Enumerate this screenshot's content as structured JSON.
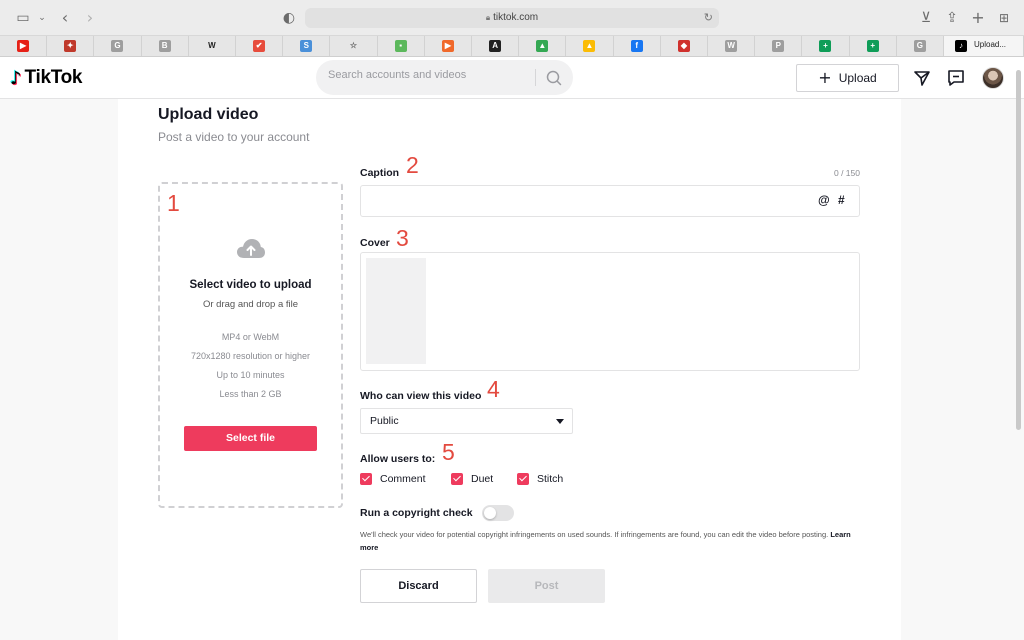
{
  "browser": {
    "url": "tiktok.com",
    "active_tab_label": "Upload..."
  },
  "bookmarks": [
    {
      "icon": "youtube-icon",
      "glyph": "▶",
      "color": "#e62117"
    },
    {
      "icon": "app-icon-red",
      "glyph": "✦",
      "color": "#c0392b"
    },
    {
      "icon": "letter-g-icon",
      "glyph": "G",
      "color": "#9e9e9e"
    },
    {
      "icon": "letter-b-icon",
      "glyph": "B",
      "color": "#9e9e9e"
    },
    {
      "icon": "wikipedia-icon",
      "glyph": "W",
      "color": "#ffffff"
    },
    {
      "icon": "checkmark-icon",
      "glyph": "✔",
      "color": "#e74c3c"
    },
    {
      "icon": "letter-s-icon",
      "glyph": "S",
      "color": "#4a90d9"
    },
    {
      "icon": "star-icon",
      "glyph": "☆",
      "color": "#666666"
    },
    {
      "icon": "green-app-icon",
      "glyph": "▪",
      "color": "#5cb85c"
    },
    {
      "icon": "orange-play-icon",
      "glyph": "▶",
      "color": "#f0692b"
    },
    {
      "icon": "adobe-icon",
      "glyph": "A",
      "color": "#222222"
    },
    {
      "icon": "google-drive-icon",
      "glyph": "▲",
      "color": "#34a853"
    },
    {
      "icon": "google-drive-icon-2",
      "glyph": "▲",
      "color": "#fbbc05"
    },
    {
      "icon": "facebook-icon",
      "glyph": "f",
      "color": "#1877f2"
    },
    {
      "icon": "red-app-icon",
      "glyph": "◆",
      "color": "#d0312d"
    },
    {
      "icon": "letter-w-icon",
      "glyph": "W",
      "color": "#9e9e9e"
    },
    {
      "icon": "letter-p-icon",
      "glyph": "P",
      "color": "#9e9e9e"
    },
    {
      "icon": "google-sheets-icon",
      "glyph": "+",
      "color": "#0f9d58"
    },
    {
      "icon": "google-sheets-icon-2",
      "glyph": "+",
      "color": "#0f9d58"
    },
    {
      "icon": "letter-g-icon-2",
      "glyph": "G",
      "color": "#9e9e9e"
    }
  ],
  "header": {
    "logo_text": "TikTok",
    "search_placeholder": "Search accounts and videos",
    "upload_label": "Upload"
  },
  "upload": {
    "title": "Upload video",
    "subtitle": "Post a video to your account",
    "dropzone": {
      "title": "Select video to upload",
      "subtitle": "Or drag and drop a file",
      "specs": [
        "MP4 or WebM",
        "720x1280 resolution or higher",
        "Up to 10 minutes",
        "Less than 2 GB"
      ],
      "button": "Select file"
    },
    "caption": {
      "label": "Caption",
      "counter": "0 / 150",
      "value": "",
      "mention": "@",
      "hashtag": "#"
    },
    "cover_label": "Cover",
    "privacy": {
      "label": "Who can view this video",
      "value": "Public"
    },
    "allow": {
      "label": "Allow users to:",
      "options": [
        {
          "label": "Comment",
          "checked": true
        },
        {
          "label": "Duet",
          "checked": true
        },
        {
          "label": "Stitch",
          "checked": true
        }
      ]
    },
    "copyright": {
      "label": "Run a copyright check",
      "enabled": false,
      "note": "We'll check your video for potential copyright infringements on used sounds. If infringements are found, you can edit the video before posting.",
      "learn_more": "Learn more"
    },
    "discard": "Discard",
    "post": "Post"
  },
  "annotations": [
    "1",
    "2",
    "3",
    "4",
    "5"
  ],
  "colors": {
    "accent": "#ee3b5d",
    "annotation": "#e34a3f"
  }
}
